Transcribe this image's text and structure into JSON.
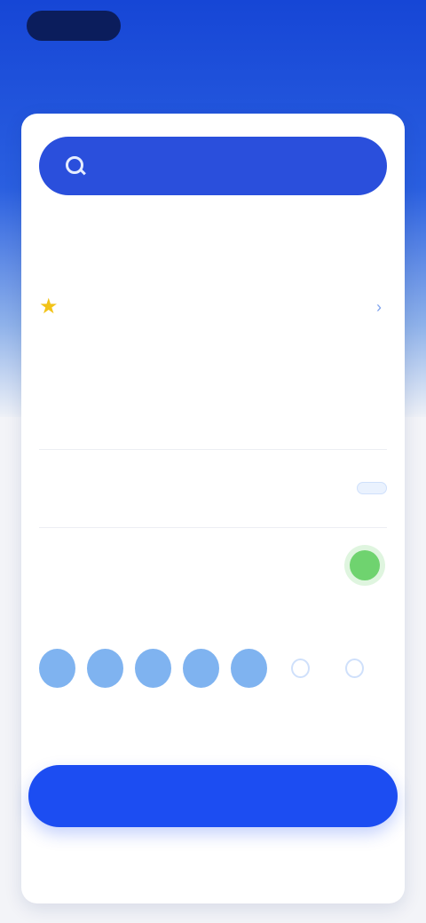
{
  "status_bar": {
    "pill_text": "",
    "right_text": ""
  },
  "header": {
    "title": ""
  },
  "search": {
    "placeholder": "",
    "value": ""
  },
  "section": {
    "label": ""
  },
  "selection": {
    "name": "",
    "star_icon": "star-icon",
    "chevron_icon": "chevron-right-icon"
  },
  "details": [
    {
      "label": "",
      "value": ""
    },
    {
      "label": "",
      "value": ""
    }
  ],
  "option": {
    "label": "",
    "button_label": ""
  },
  "toggle": {
    "title": "",
    "description": "",
    "on": true
  },
  "rating": {
    "label": "",
    "value_text": "",
    "filled": 5,
    "total": 7
  },
  "footnote": "",
  "submit": {
    "label": ""
  },
  "colors": {
    "primary": "#1c4df2",
    "search_bg": "#2a4fdc",
    "accent_star": "#f2c318",
    "toggle_on": "#6fd36f"
  }
}
